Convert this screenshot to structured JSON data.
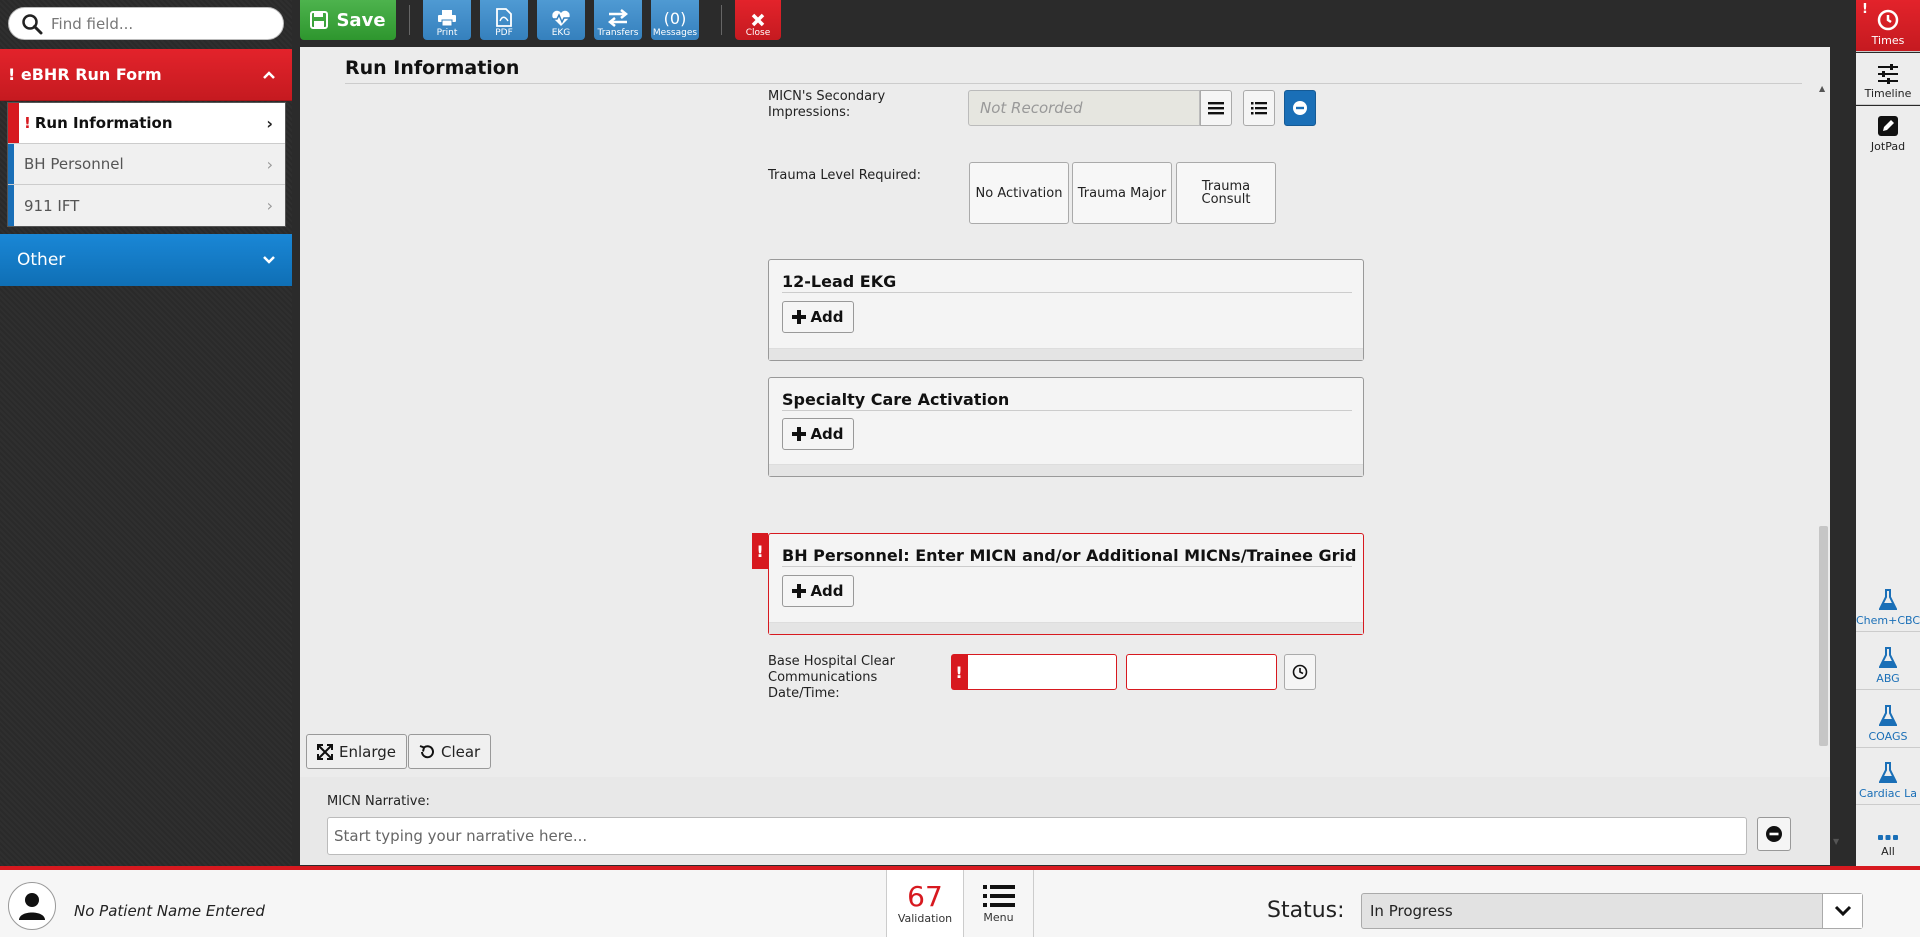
{
  "search": {
    "placeholder": "Find field..."
  },
  "sidebar": {
    "form_section": {
      "title": "eBHR Run Form",
      "alert": "!"
    },
    "items": [
      {
        "label": "Run Information",
        "alert": "!"
      },
      {
        "label": "BH Personnel"
      },
      {
        "label": "911 IFT"
      }
    ],
    "other_section": {
      "title": "Other"
    }
  },
  "toolbar": {
    "save_label": "Save",
    "print_label": "Print",
    "pdf_label": "PDF",
    "ekg_label": "EKG",
    "transfers_label": "Transfers",
    "messages_count": "(0)",
    "messages_label": "Messages",
    "close_label": "Close"
  },
  "main": {
    "title": "Run Information",
    "secondary_impressions": {
      "label": "MICN's Secondary Impressions:",
      "value": "Not Recorded"
    },
    "trauma": {
      "label": "Trauma Level Required:",
      "options": [
        "No Activation",
        "Trauma Major",
        "Trauma Consult"
      ]
    },
    "panels": [
      {
        "title": "12-Lead EKG",
        "add_label": "Add"
      },
      {
        "title": "Specialty Care Activation",
        "add_label": "Add"
      },
      {
        "title": "BH Personnel: Enter MICN and/or Additional MICNs/Trainee Grid",
        "add_label": "Add",
        "alert": "!"
      }
    ],
    "clear_comm": {
      "label": "Base Hospital Clear Communications Date/Time:",
      "alert": "!"
    },
    "enlarge_label": "Enlarge",
    "clear_label": "Clear"
  },
  "narrative": {
    "label": "MICN Narrative:",
    "placeholder": "Start typing your narrative here..."
  },
  "rail": {
    "times_label": "Times",
    "times_alert": "!",
    "timeline_label": "Timeline",
    "jotpad_label": "JotPad",
    "labs": [
      "Chem+CBC",
      "ABG",
      "COAGS",
      "Cardiac La"
    ],
    "all_label": "All"
  },
  "footer": {
    "patient_name": "No Patient Name Entered",
    "validation_count": "67",
    "validation_label": "Validation",
    "menu_label": "Menu",
    "status_label": "Status:",
    "status_value": "In Progress"
  },
  "colors": {
    "red": "#d7191f",
    "blue": "#1a6fb7",
    "green": "#3aa63a"
  }
}
